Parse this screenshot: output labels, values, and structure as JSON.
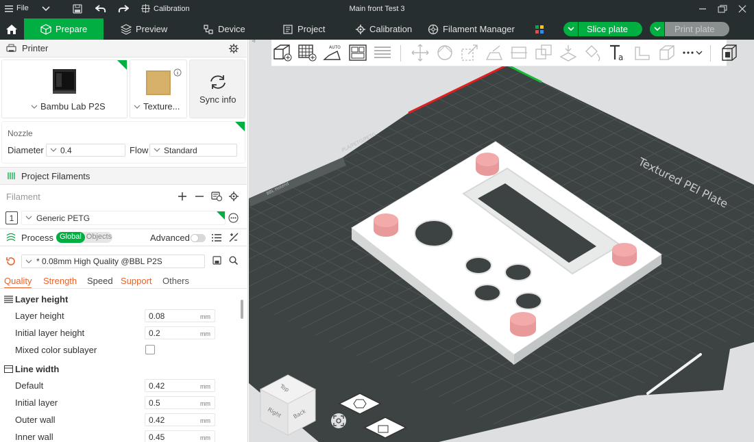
{
  "titlebar": {
    "file_label": "File",
    "calibration_label": "Calibration",
    "window_title": "Main front Test 3"
  },
  "nav": {
    "prepare": "Prepare",
    "preview": "Preview",
    "device": "Device",
    "project": "Project",
    "calibration": "Calibration",
    "filament_manager": "Filament Manager",
    "slice_plate": "Slice plate",
    "print_plate": "Print plate"
  },
  "printer": {
    "section_title": "Printer",
    "printer_name": "Bambu Lab P2S",
    "plate_name": "Texture...",
    "sync_label": "Sync info",
    "nozzle_label": "Nozzle",
    "diameter_label": "Diameter",
    "diameter_value": "0.4",
    "flow_label": "Flow",
    "flow_value": "Standard"
  },
  "filaments": {
    "section_title": "Project Filaments",
    "filament_label": "Filament",
    "slot_number": "1",
    "filament_name": "Generic PETG"
  },
  "process": {
    "section_title": "Process",
    "toggle_global": "Global",
    "toggle_objects": "Objects",
    "advanced_label": "Advanced",
    "preset_name": "* 0.08mm High Quality @BBL P2S",
    "tabs": {
      "quality": "Quality",
      "strength": "Strength",
      "speed": "Speed",
      "support": "Support",
      "others": "Others"
    },
    "layer_height_group": {
      "title": "Layer height",
      "rows": [
        {
          "label": "Layer height",
          "value": "0.08",
          "unit": "mm"
        },
        {
          "label": "Initial layer height",
          "value": "0.2",
          "unit": "mm"
        },
        {
          "label": "Mixed color sublayer"
        }
      ]
    },
    "line_width_group": {
      "title": "Line width",
      "rows": [
        {
          "label": "Default",
          "value": "0.42",
          "unit": "mm"
        },
        {
          "label": "Initial layer",
          "value": "0.5",
          "unit": "mm"
        },
        {
          "label": "Outer wall",
          "value": "0.42",
          "unit": "mm"
        },
        {
          "label": "Inner wall",
          "value": "0.45",
          "unit": "mm"
        }
      ]
    }
  },
  "plate": {
    "name_label": "Textured PEI Plate",
    "side_label": "PLA/PETG/PETG",
    "brand_label": "BBL Hotend",
    "view_cube": {
      "top": "Top",
      "right": "Right",
      "back": "Back"
    }
  },
  "colors": {
    "accent": "#00ae42",
    "dark_bar": "#262e30",
    "bed": "#3d4242",
    "support_pink": "#f2aaaa"
  }
}
